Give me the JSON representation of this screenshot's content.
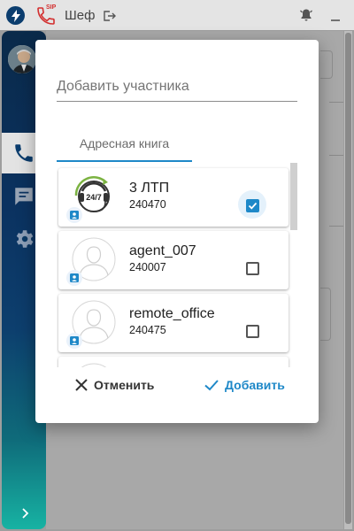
{
  "app": {
    "title": "Шеф",
    "sip_label": "SIP"
  },
  "dialog": {
    "input_placeholder": "Добавить участника",
    "tab_label": "Адресная книга",
    "contacts": [
      {
        "name": "3 ЛТП",
        "number": "240470",
        "checked": true,
        "avatar": "support-24-7-icon"
      },
      {
        "name": "agent_007",
        "number": "240007",
        "checked": false,
        "avatar": "user-placeholder-icon"
      },
      {
        "name": "remote_office",
        "number": "240475",
        "checked": false,
        "avatar": "user-placeholder-icon"
      }
    ],
    "cancel_label": "Отменить",
    "add_label": "Добавить"
  },
  "colors": {
    "accent": "#1e88c8",
    "sidebar_top": "#0a2a4a",
    "sidebar_bottom": "#17b3a3",
    "sip_red": "#d32f2f"
  }
}
